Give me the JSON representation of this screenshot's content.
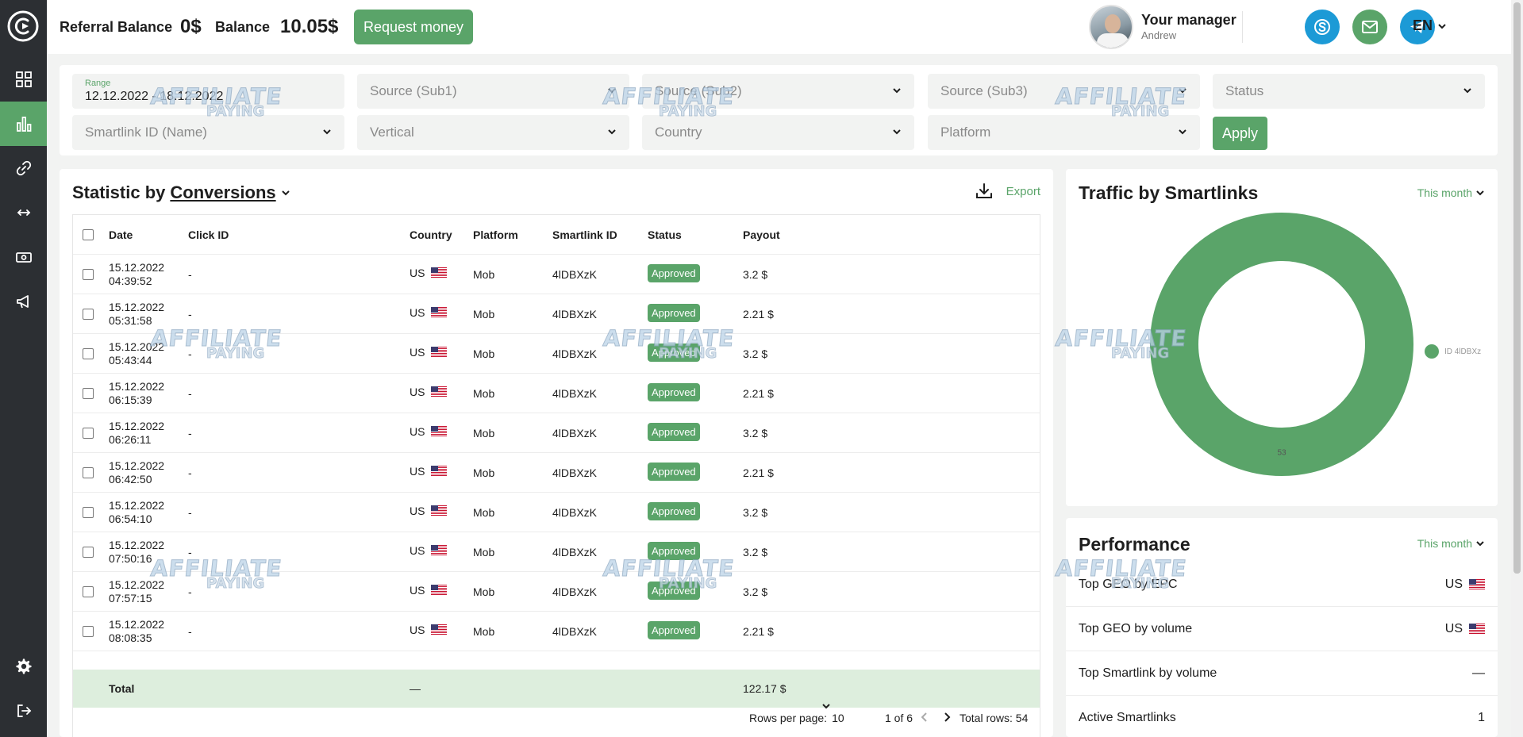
{
  "sidebar": {
    "logo_icon": "logo-c-icon",
    "items": [
      {
        "name": "dashboard",
        "icon": "grid-icon"
      },
      {
        "name": "statistics",
        "icon": "bar-chart-icon",
        "active": true
      },
      {
        "name": "smartlinks",
        "icon": "link-icon"
      },
      {
        "name": "postback",
        "icon": "arrows-horizontal-icon"
      },
      {
        "name": "payments",
        "icon": "money-icon"
      },
      {
        "name": "promo",
        "icon": "megaphone-icon"
      }
    ],
    "bottom": [
      {
        "name": "settings",
        "icon": "gear-icon"
      },
      {
        "name": "logout",
        "icon": "logout-icon"
      }
    ]
  },
  "header": {
    "referral_label": "Referral Balance",
    "referral_value": "0$",
    "balance_label": "Balance",
    "balance_value": "10.05$",
    "request_button": "Request money",
    "manager_title": "Your manager",
    "manager_name": "Andrew",
    "contacts": [
      {
        "name": "skype",
        "icon": "skype-icon",
        "color": "#1c9ad6"
      },
      {
        "name": "email",
        "icon": "mail-icon",
        "color": "#5aa469"
      },
      {
        "name": "telegram",
        "icon": "telegram-icon",
        "color": "#1c9ad6"
      }
    ],
    "language": "EN"
  },
  "filters": {
    "range_label": "Range",
    "range_value": "12.12.2022 - 18.12.2022",
    "sub1": "Source (Sub1)",
    "sub2": "Source (Sub2)",
    "sub3": "Source (Sub3)",
    "status": "Status",
    "smartlink": "Smartlink ID (Name)",
    "vertical": "Vertical",
    "country": "Country",
    "platform": "Platform",
    "apply": "Apply"
  },
  "stats": {
    "title_prefix": "Statistic by",
    "title_link": "Conversions",
    "export": "Export",
    "columns": [
      "Date",
      "Click ID",
      "Country",
      "Platform",
      "Smartlink ID",
      "Status",
      "Payout"
    ],
    "rows": [
      {
        "date": "15.12.2022",
        "time": "04:39:52",
        "click": "-",
        "country": "US",
        "platform": "Mob",
        "smartlink": "4lDBXzK",
        "status": "Approved",
        "payout": "3.2 $"
      },
      {
        "date": "15.12.2022",
        "time": "05:31:58",
        "click": "-",
        "country": "US",
        "platform": "Mob",
        "smartlink": "4lDBXzK",
        "status": "Approved",
        "payout": "2.21 $"
      },
      {
        "date": "15.12.2022",
        "time": "05:43:44",
        "click": "-",
        "country": "US",
        "platform": "Mob",
        "smartlink": "4lDBXzK",
        "status": "Approved",
        "payout": "3.2 $"
      },
      {
        "date": "15.12.2022",
        "time": "06:15:39",
        "click": "-",
        "country": "US",
        "platform": "Mob",
        "smartlink": "4lDBXzK",
        "status": "Approved",
        "payout": "2.21 $"
      },
      {
        "date": "15.12.2022",
        "time": "06:26:11",
        "click": "-",
        "country": "US",
        "platform": "Mob",
        "smartlink": "4lDBXzK",
        "status": "Approved",
        "payout": "3.2 $"
      },
      {
        "date": "15.12.2022",
        "time": "06:42:50",
        "click": "-",
        "country": "US",
        "platform": "Mob",
        "smartlink": "4lDBXzK",
        "status": "Approved",
        "payout": "2.21 $"
      },
      {
        "date": "15.12.2022",
        "time": "06:54:10",
        "click": "-",
        "country": "US",
        "platform": "Mob",
        "smartlink": "4lDBXzK",
        "status": "Approved",
        "payout": "3.2 $"
      },
      {
        "date": "15.12.2022",
        "time": "07:50:16",
        "click": "-",
        "country": "US",
        "platform": "Mob",
        "smartlink": "4lDBXzK",
        "status": "Approved",
        "payout": "3.2 $"
      },
      {
        "date": "15.12.2022",
        "time": "07:57:15",
        "click": "-",
        "country": "US",
        "platform": "Mob",
        "smartlink": "4lDBXzK",
        "status": "Approved",
        "payout": "3.2 $"
      },
      {
        "date": "15.12.2022",
        "time": "08:08:35",
        "click": "-",
        "country": "US",
        "platform": "Mob",
        "smartlink": "4lDBXzK",
        "status": "Approved",
        "payout": "2.21 $"
      }
    ],
    "total_label": "Total",
    "total_country": "—",
    "total_payout": "122.17 $",
    "rows_per_page_label": "Rows per page:",
    "rows_per_page": "10",
    "page_info": "1 of 6",
    "total_rows": "Total rows: 54"
  },
  "traffic": {
    "title": "Traffic by Smartlinks",
    "period": "This month",
    "legend": "ID 4lDBXz",
    "color": "#5aa469",
    "value_label": "53"
  },
  "chart_data": {
    "type": "pie",
    "categories": [
      "ID 4lDBXz"
    ],
    "values": [
      53
    ],
    "title": "Traffic by Smartlinks"
  },
  "performance": {
    "title": "Performance",
    "period": "This month",
    "rows": [
      {
        "label": "Top GEO by EPC",
        "value": "US",
        "flag": true
      },
      {
        "label": "Top GEO by volume",
        "value": "US",
        "flag": true
      },
      {
        "label": "Top Smartlink by volume",
        "value": "—",
        "flag": false
      },
      {
        "label": "Active Smartlinks",
        "value": "1",
        "flag": false
      }
    ]
  },
  "watermark": {
    "line1": "AFFILIATE",
    "line2": "PAYING"
  }
}
